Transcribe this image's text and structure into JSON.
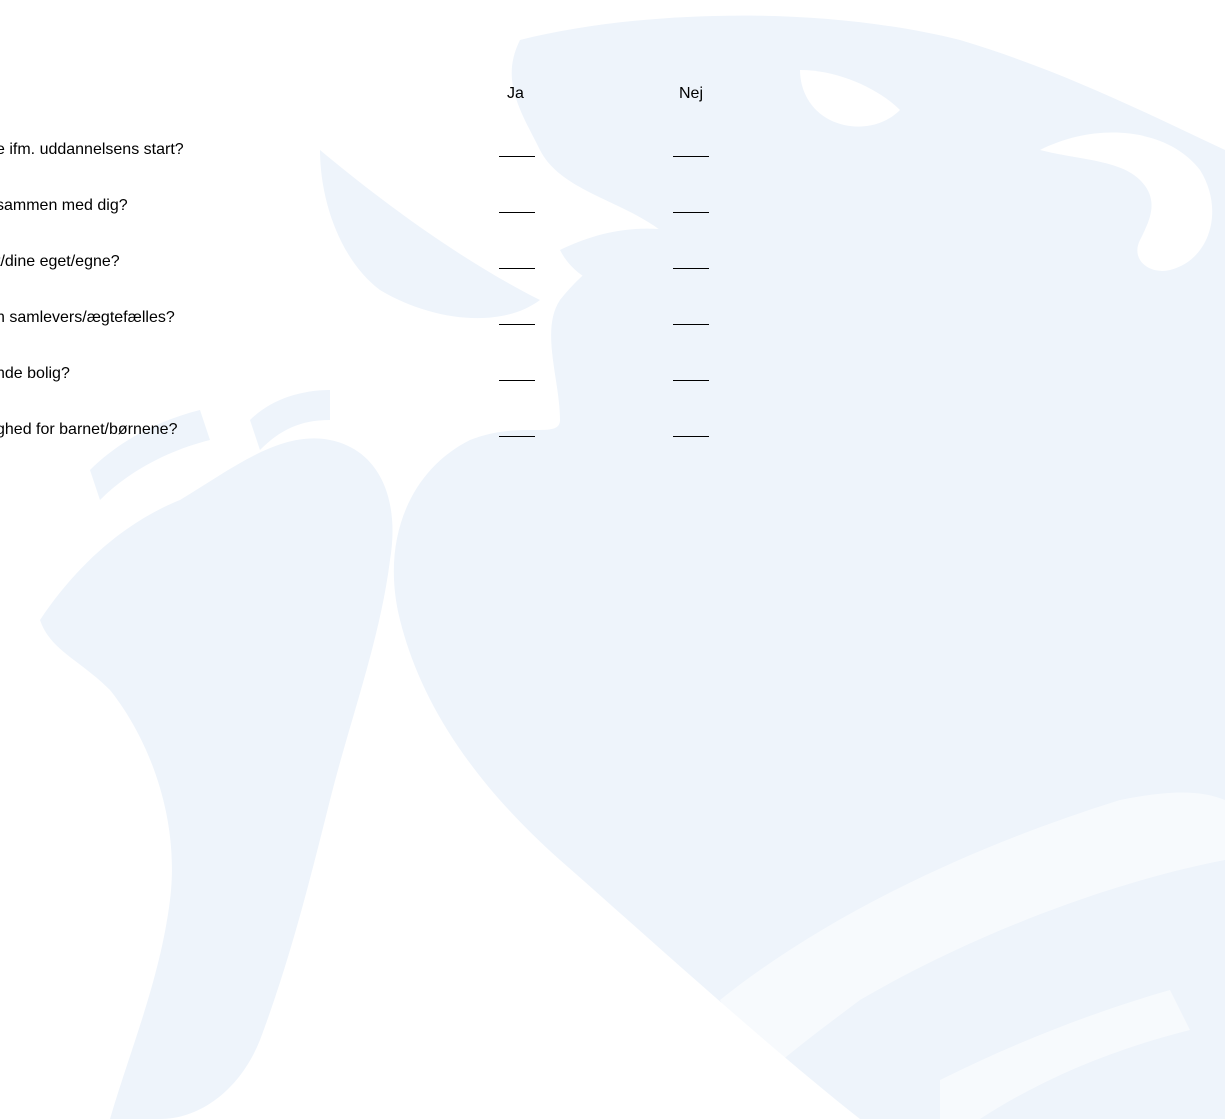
{
  "form": {
    "columns": {
      "yes": "Ja",
      "no": "Nej"
    },
    "questions": [
      {
        "text": "e ifm. uddannelsens start?"
      },
      {
        "text": "sammen med dig?"
      },
      {
        "text": "t/dine eget/egne?"
      },
      {
        "text": "n samlevers/ægtefælles?"
      },
      {
        "text": "nde bolig?"
      },
      {
        "text": "ghed for barnet/børnene?"
      }
    ]
  },
  "watermark": {
    "icon": "heraldic-lion-watermark",
    "color": "#eef4fb"
  }
}
